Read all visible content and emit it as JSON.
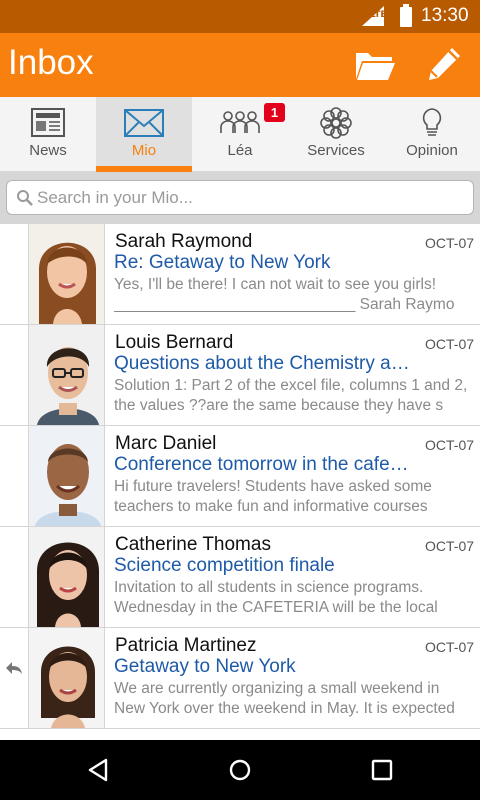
{
  "status_bar": {
    "network": "LTE",
    "time": "13:30"
  },
  "app_bar": {
    "title": "Inbox"
  },
  "tabs": [
    {
      "label": "News",
      "icon": "newspaper-icon",
      "active": false
    },
    {
      "label": "Mio",
      "icon": "envelope-icon",
      "active": true
    },
    {
      "label": "Léa",
      "icon": "group-icon",
      "active": false,
      "badge": "1"
    },
    {
      "label": "Services",
      "icon": "flower-icon",
      "active": false
    },
    {
      "label": "Opinion",
      "icon": "lightbulb-icon",
      "active": false
    }
  ],
  "search": {
    "placeholder": "Search in your Mio..."
  },
  "messages": [
    {
      "name": "Sarah Raymond",
      "date": "OCT-07",
      "subject": "Re: Getaway to New York",
      "preview": "Yes, I'll be there! I can not wait to see you girls! ____________________________ Sarah Raymo",
      "replied": false
    },
    {
      "name": "Louis Bernard",
      "date": "OCT-07",
      "subject": "Questions about the Chemistry a…",
      "preview": "Solution 1: Part 2 of the excel file, columns 1 and 2, the values ??are the same because they have s",
      "replied": false
    },
    {
      "name": "Marc Daniel",
      "date": "OCT-07",
      "subject": "Conference tomorrow in the cafe…",
      "preview": "Hi future travelers! Students have asked some teachers to make fun and informative courses",
      "replied": false
    },
    {
      "name": "Catherine Thomas",
      "date": "OCT-07",
      "subject": "Science competition finale",
      "preview": "Invitation to all students in science programs. Wednesday in the CAFETERIA will be the local",
      "replied": false
    },
    {
      "name": "Patricia Martinez",
      "date": "OCT-07",
      "subject": "Getaway to New York",
      "preview": "We are currently organizing a small weekend in New York over the weekend in May. It is expected",
      "replied": true
    }
  ],
  "colors": {
    "accent": "#f7800e",
    "status_bar": "#b85a00",
    "subject": "#1e5aa8",
    "badge": "#e3001b"
  }
}
